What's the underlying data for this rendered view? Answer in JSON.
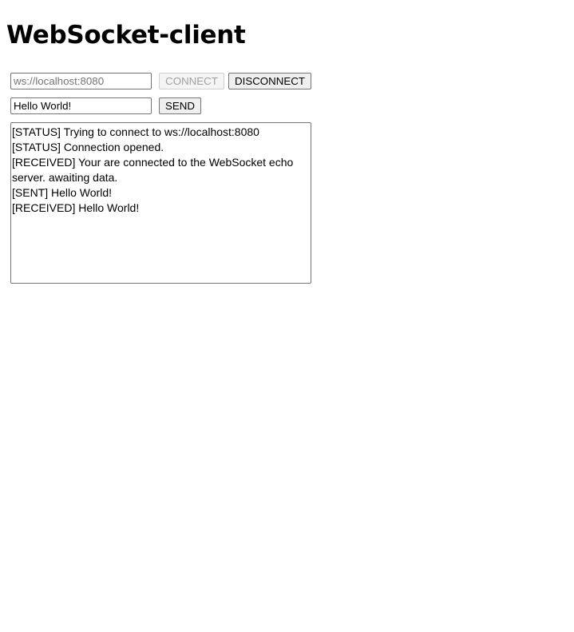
{
  "page": {
    "title": "WebSocket-client"
  },
  "connection": {
    "url_value": "",
    "url_placeholder": "ws://localhost:8080",
    "connect_label": "CONNECT",
    "connect_disabled": true,
    "disconnect_label": "DISCONNECT"
  },
  "message": {
    "value": "Hello World!",
    "send_label": "SEND"
  },
  "log": {
    "lines": [
      "[STATUS] Trying to connect to ws://localhost:8080",
      "[STATUS] Connection opened.",
      "[RECEIVED] Your are connected to the WebSocket echo server. awaiting data.",
      "[SENT] Hello World!",
      "[RECEIVED] Hello World!"
    ]
  }
}
